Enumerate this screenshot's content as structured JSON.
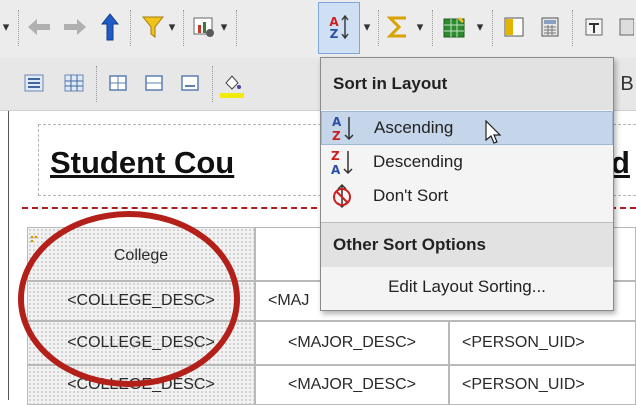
{
  "toolbar": {
    "row1_icons": [
      "dropdown-arrow-icon",
      "back-arrow-icon",
      "forward-arrow-icon",
      "up-arrow-icon",
      "filter-icon",
      "chart-icon",
      "sort-icon",
      "sum-icon",
      "spreadsheet-icon",
      "panel-icon",
      "calculator-icon",
      "extra-icon"
    ],
    "row2_icons": [
      "align-icon",
      "grid-icon",
      "border-icon",
      "border-icon-2",
      "border-icon-3",
      "fill-color-icon"
    ]
  },
  "report": {
    "title": "Student Cou",
    "title_end": "d",
    "header_college": "College",
    "rows": [
      [
        "<COLLEGE_DESC>",
        "<MAJ",
        ""
      ],
      [
        "<COLLEGE_DESC>",
        "<MAJOR_DESC>",
        "<PERSON_UID>"
      ],
      [
        "<COLLEGE_DESC>",
        "<MAJOR_DESC>",
        "<PERSON_UID>"
      ]
    ]
  },
  "menu": {
    "section1": "Sort in Layout",
    "items": [
      {
        "label": "Ascending",
        "icon": "sort-ascending-icon"
      },
      {
        "label": "Descending",
        "icon": "sort-descending-icon"
      },
      {
        "label": "Don't Sort",
        "icon": "no-sort-icon"
      }
    ],
    "section2": "Other Sort Options",
    "edit_item": "Edit Layout Sorting..."
  },
  "letters": {
    "a": "A",
    "z": "Z",
    "b": "B",
    "caret": "▾"
  },
  "colors": {
    "highlight": "#c5d5ea",
    "oval": "#b3201a",
    "sort_red": "#cc1f1f",
    "sort_blue": "#2a4fa6"
  }
}
